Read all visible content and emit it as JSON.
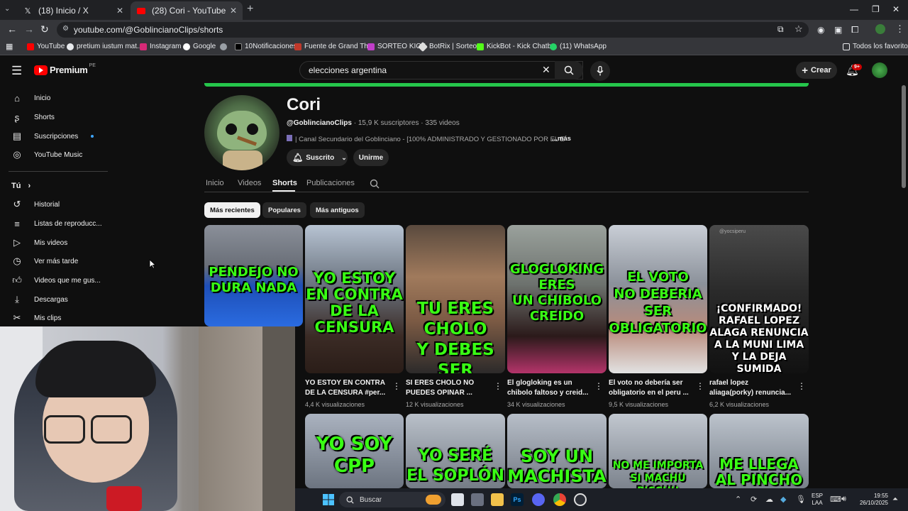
{
  "browser": {
    "tabs": [
      {
        "label": "(18) Inicio / X"
      },
      {
        "label": "(28) Cori - YouTube"
      }
    ],
    "url": "youtube.com/@GoblincianoClips/shorts",
    "bookmarks": [
      "YouTube",
      "pretium iustum mat...",
      "Instagram",
      "Google",
      "10Notificaciones",
      "Fuente de Grand Th...",
      "SORTEO KICK",
      "BotRix | Sorteos",
      "KickBot - Kick Chatb...",
      "(11) WhatsApp"
    ],
    "all_bookmarks": "Todos los favoritos"
  },
  "header": {
    "logo": "Premium",
    "logo_region": "PE",
    "search_value": "elecciones argentina",
    "create_label": "Crear",
    "notif_badge": "9+"
  },
  "sidebar": {
    "main": [
      "Inicio",
      "Shorts",
      "Suscripciones",
      "YouTube Music"
    ],
    "you_label": "Tú",
    "you_items": [
      "Historial",
      "Listas de reproducc...",
      "Mis videos",
      "Ver más tarde",
      "Videos que me gus...",
      "Descargas",
      "Mis clips"
    ]
  },
  "channel": {
    "name": "Cori",
    "handle": "@GoblincianoClips",
    "meta": "· 15,9 K suscriptores · 335 videos",
    "description": "| Canal Secundario del Goblinciano - [100% ADMINISTRADO Y GESTIONADO POR EL E",
    "more": "...más",
    "subscribed_label": "Suscrito",
    "join_label": "Unirme",
    "tabs": [
      "Inicio",
      "Videos",
      "Shorts",
      "Publicaciones"
    ],
    "chips": [
      "Más recientes",
      "Populares",
      "Más antiguos"
    ]
  },
  "shorts_row1": [
    {
      "caption": "PENDEJO NO\nDURA NADA",
      "title": "",
      "views": ""
    },
    {
      "caption": "YO ESTOY\nEN CONTRA\nDE LA\nCENSURA",
      "title": "YO ESTOY EN CONTRA DE LA CENSURA  #per...",
      "views": "4,4 K visualizaciones"
    },
    {
      "caption": "TU ERES\nCHOLO\nY DEBES\nSER PROGRE",
      "title": "SI ERES CHOLO NO PUEDES OPINAR ...",
      "views": "12 K visualizaciones"
    },
    {
      "caption": "GLOGLOKING\nERES\nUN CHIBOLO\nCREIDO",
      "title": "El glogloking es un chibolo faltoso y creid...",
      "views": "34 K visualizaciones"
    },
    {
      "caption": "EL VOTO\nNO DEBERIA\nSER\nOBLIGATORIO",
      "title": "El voto no debería ser obligatorio en el peru ...",
      "views": "9,5 K visualizaciones"
    },
    {
      "caption": "¡CONFIRMADO!\nRAFAEL LOPEZ\nALAGA RENUNCIA\nA LA MUNI LIMA\nY LA DEJA SUMIDA\nEN DELINCUENCIA",
      "title": "rafael lopez aliaga(porky) renuncia...",
      "views": "6,2 K visualizaciones",
      "watermark": "@yocsiperu"
    }
  ],
  "shorts_row2": [
    {
      "caption": "YO SOY\nCPP"
    },
    {
      "caption": "YO SERÉ\nEL SOPLÓN"
    },
    {
      "caption": "SOY UN\nMACHISTA"
    },
    {
      "caption": "NO ME IMPORTA\nSI MACHU PICCHU"
    },
    {
      "caption": "ME LLEGA\nAL PINCHO"
    }
  ],
  "taskbar": {
    "search_label": "Buscar",
    "lang": "ESP",
    "lang2": "LAA",
    "time": "19:55",
    "date": "26/10/2025"
  },
  "colors": {
    "accent_green": "#39ff14",
    "yt_red": "#ff0000",
    "bg": "#0f0f0f"
  }
}
